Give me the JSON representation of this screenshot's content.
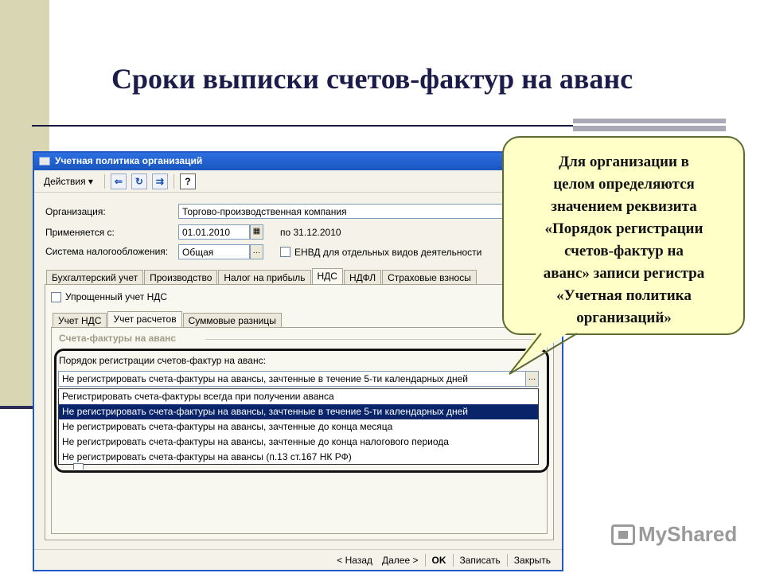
{
  "slide": {
    "title": "Сроки выписки счетов-фактур на аванс"
  },
  "window": {
    "title": "Учетная политика организаций",
    "toolbar": {
      "actions_label": "Действия ▾",
      "help_label": "?"
    },
    "form": {
      "org_label": "Организация:",
      "org_value": "Торгово-производственная компания",
      "applies_label": "Применяется с:",
      "applies_value": "01.01.2010",
      "to_label": "по 31.12.2010",
      "tax_label": "Система налогообложения:",
      "tax_value": "Общая",
      "envd_label": "ЕНВД для отдельных видов деятельности",
      "envd_checked": false
    },
    "tabs": [
      "Бухгалтерский учет",
      "Производство",
      "Налог на прибыль",
      "НДС",
      "НДФЛ",
      "Страховые взносы"
    ],
    "active_tab": "НДС",
    "vat_panel": {
      "simplified_label": "Упрощенный учет НДС",
      "simplified_checked": false,
      "subtabs": [
        "Учет НДС",
        "Учет расчетов",
        "Суммовые разницы"
      ],
      "active_subtab": "Учет расчетов",
      "group_title": "Счета-фактуры на аванс",
      "order_label": "Порядок регистрации счетов-фактур на аванс:",
      "combo_value": "Не регистрировать счета-фактуры на авансы, зачтенные в течение 5-ти календарных дней",
      "dropdown_options": [
        "Регистрировать счета-фактуры всегда при получении аванса",
        "Не регистрировать счета-фактуры на авансы, зачтенные в течение 5-ти календарных дней",
        "Не регистрировать счета-фактуры на авансы, зачтенные до конца месяца",
        "Не регистрировать счета-фактуры на авансы, зачтенные до конца налогового периода",
        "Не регистрировать счета-фактуры на авансы (п.13 ст.167 НК РФ)"
      ],
      "selected_option_index": 1
    },
    "bottom_bar": {
      "back": "< Назад",
      "next": "Далее >",
      "ok": "OK",
      "save": "Записать",
      "close": "Закрыть"
    }
  },
  "callout": {
    "text_lines": [
      "Для организации в",
      "целом определяются",
      "значением реквизита",
      "«Порядок регистрации",
      "счетов-фактур на",
      "аванс» записи регистра",
      "«Учетная политика",
      "организаций»"
    ]
  },
  "watermark": {
    "text": "MyShared"
  },
  "colors": {
    "title_bar": "#1a55c0",
    "selection": "#0a246a",
    "callout_fill": "#ffffc8",
    "left_band": "#d9d6b4"
  }
}
